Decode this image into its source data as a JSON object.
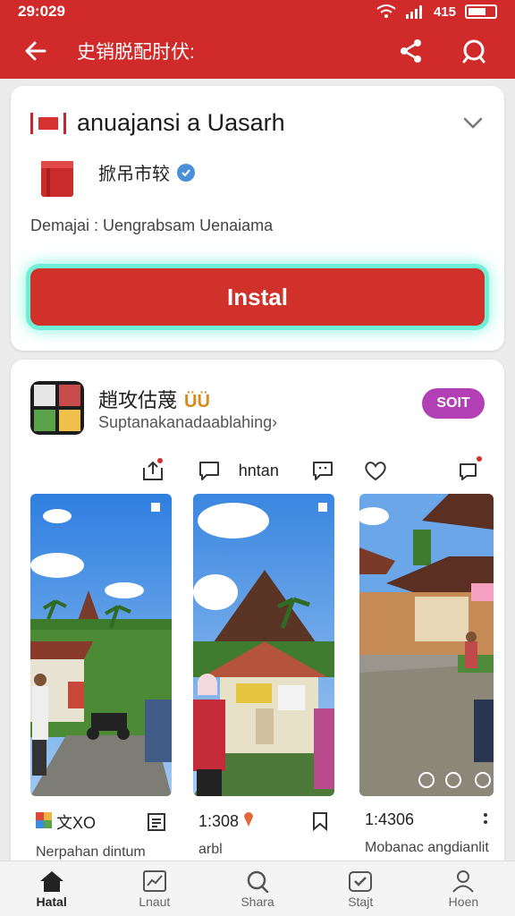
{
  "status": {
    "time": "29:029",
    "signal_text": "415"
  },
  "appbar": {
    "title": "史销脱配肘伏:"
  },
  "app": {
    "name": "anuajansi a Uasarh",
    "publisher": "掀吊市较",
    "description": "Demajai : Uengrabsam Uenaiama",
    "install_label": "Instal"
  },
  "post": {
    "title": "趙攻估蔑",
    "badge": "ÜÜ",
    "subtitle": "Suptanakanadaablahing›",
    "pill_label": "SOIT",
    "action_label": "hntan"
  },
  "gallery": [
    {
      "label": "文XO",
      "caption": "Nerpahan dintum"
    },
    {
      "label": "1:308",
      "caption": "arbl"
    },
    {
      "label": "1:4306",
      "caption": "Mobanac angdianlit"
    }
  ],
  "bottom_nav": [
    {
      "label": "Hatal",
      "icon": "home-icon",
      "active": true
    },
    {
      "label": "Lnaut",
      "icon": "chart-icon",
      "active": false
    },
    {
      "label": "Shara",
      "icon": "search-icon",
      "active": false
    },
    {
      "label": "Stajt",
      "icon": "check-calendar-icon",
      "active": false
    },
    {
      "label": "Hoen",
      "icon": "profile-icon",
      "active": false
    }
  ],
  "colors": {
    "brand": "#d12a2a",
    "install": "#d0312b",
    "glow": "#6ff0d6",
    "pill": "#b23fb4"
  }
}
